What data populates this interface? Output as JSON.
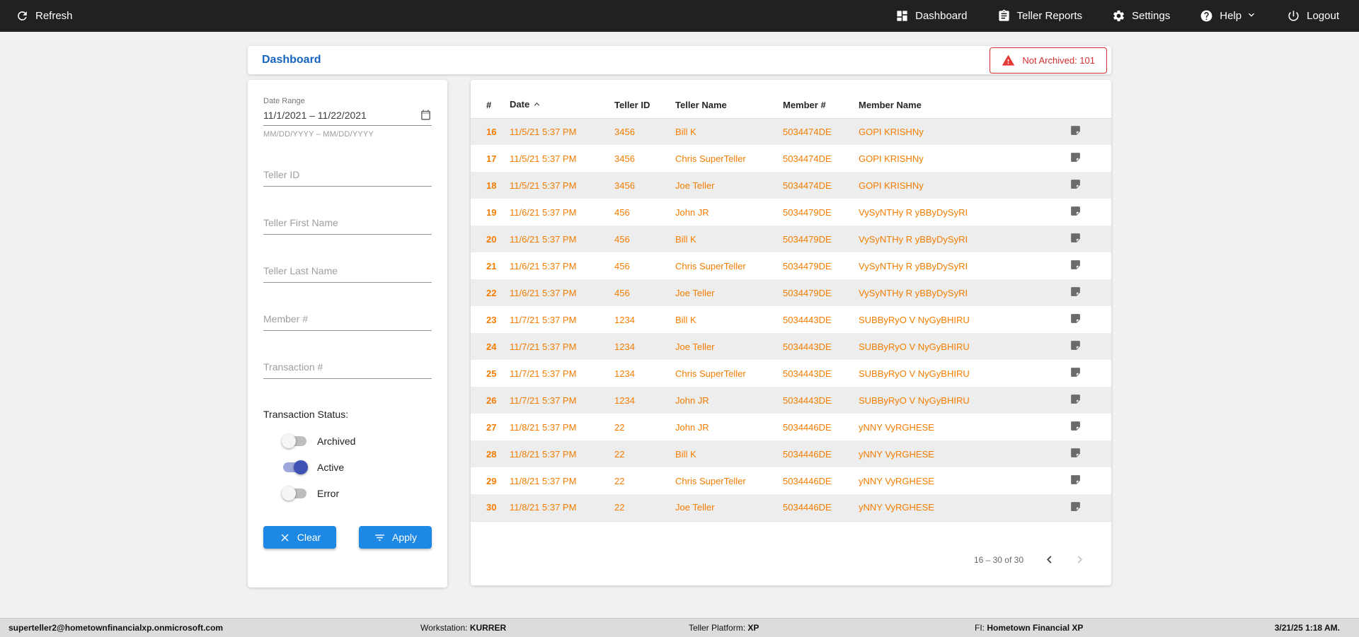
{
  "colors": {
    "accent_blue": "#1E88E5",
    "title_blue": "#1565C0",
    "row_orange": "#F57C00",
    "alert_red": "#D32F2F",
    "toggle_active_blue": "#3F51B5",
    "topnav_bg": "#212121"
  },
  "topnav": {
    "refresh_label": "Refresh",
    "items": [
      {
        "label": "Dashboard",
        "icon": "dashboard-icon"
      },
      {
        "label": "Teller Reports",
        "icon": "teller-reports-icon"
      },
      {
        "label": "Settings",
        "icon": "settings-icon"
      },
      {
        "label": "Help",
        "icon": "help-icon"
      },
      {
        "label": "Logout",
        "icon": "logout-icon"
      }
    ]
  },
  "header": {
    "title": "Dashboard",
    "not_archived_badge": "Not Archived: 101"
  },
  "filters": {
    "date_range": {
      "label": "Date Range",
      "value": "11/1/2021 – 11/22/2021",
      "helper": "MM/DD/YYYY – MM/DD/YYYY"
    },
    "fields": [
      {
        "placeholder": "Teller ID"
      },
      {
        "placeholder": "Teller First Name"
      },
      {
        "placeholder": "Teller Last Name"
      },
      {
        "placeholder": "Member #"
      },
      {
        "placeholder": "Transaction #"
      }
    ],
    "status_label": "Transaction Status:",
    "toggles": [
      {
        "label": "Archived",
        "on": false
      },
      {
        "label": "Active",
        "on": true
      },
      {
        "label": "Error",
        "on": false
      }
    ],
    "clear_label": "Clear",
    "apply_label": "Apply"
  },
  "table": {
    "columns": [
      "#",
      "Date",
      "Teller ID",
      "Teller Name",
      "Member #",
      "Member Name"
    ],
    "sorted_by": "Date",
    "sort_direction": "asc",
    "rows": [
      {
        "num": "16",
        "date": "11/5/21 5:37 PM",
        "teller_id": "3456",
        "teller_name": "Bill K",
        "member_num": "5034474DE",
        "member_name": "GOPI KRISHNy"
      },
      {
        "num": "17",
        "date": "11/5/21 5:37 PM",
        "teller_id": "3456",
        "teller_name": "Chris SuperTeller",
        "member_num": "5034474DE",
        "member_name": "GOPI KRISHNy"
      },
      {
        "num": "18",
        "date": "11/5/21 5:37 PM",
        "teller_id": "3456",
        "teller_name": "Joe Teller",
        "member_num": "5034474DE",
        "member_name": "GOPI KRISHNy"
      },
      {
        "num": "19",
        "date": "11/6/21 5:37 PM",
        "teller_id": "456",
        "teller_name": "John JR",
        "member_num": "5034479DE",
        "member_name": "VySyNTHy R yBByDySyRI"
      },
      {
        "num": "20",
        "date": "11/6/21 5:37 PM",
        "teller_id": "456",
        "teller_name": "Bill K",
        "member_num": "5034479DE",
        "member_name": "VySyNTHy R yBByDySyRI"
      },
      {
        "num": "21",
        "date": "11/6/21 5:37 PM",
        "teller_id": "456",
        "teller_name": "Chris SuperTeller",
        "member_num": "5034479DE",
        "member_name": "VySyNTHy R yBByDySyRI"
      },
      {
        "num": "22",
        "date": "11/6/21 5:37 PM",
        "teller_id": "456",
        "teller_name": "Joe Teller",
        "member_num": "5034479DE",
        "member_name": "VySyNTHy R yBByDySyRI"
      },
      {
        "num": "23",
        "date": "11/7/21 5:37 PM",
        "teller_id": "1234",
        "teller_name": "Bill K",
        "member_num": "5034443DE",
        "member_name": "SUBByRyO V NyGyBHIRU"
      },
      {
        "num": "24",
        "date": "11/7/21 5:37 PM",
        "teller_id": "1234",
        "teller_name": "Joe Teller",
        "member_num": "5034443DE",
        "member_name": "SUBByRyO V NyGyBHIRU"
      },
      {
        "num": "25",
        "date": "11/7/21 5:37 PM",
        "teller_id": "1234",
        "teller_name": "Chris SuperTeller",
        "member_num": "5034443DE",
        "member_name": "SUBByRyO V NyGyBHIRU"
      },
      {
        "num": "26",
        "date": "11/7/21 5:37 PM",
        "teller_id": "1234",
        "teller_name": "John JR",
        "member_num": "5034443DE",
        "member_name": "SUBByRyO V NyGyBHIRU"
      },
      {
        "num": "27",
        "date": "11/8/21 5:37 PM",
        "teller_id": "22",
        "teller_name": "John JR",
        "member_num": "5034446DE",
        "member_name": "yNNY VyRGHESE"
      },
      {
        "num": "28",
        "date": "11/8/21 5:37 PM",
        "teller_id": "22",
        "teller_name": "Bill K",
        "member_num": "5034446DE",
        "member_name": "yNNY VyRGHESE"
      },
      {
        "num": "29",
        "date": "11/8/21 5:37 PM",
        "teller_id": "22",
        "teller_name": "Chris SuperTeller",
        "member_num": "5034446DE",
        "member_name": "yNNY VyRGHESE"
      },
      {
        "num": "30",
        "date": "11/8/21 5:37 PM",
        "teller_id": "22",
        "teller_name": "Joe Teller",
        "member_num": "5034446DE",
        "member_name": "yNNY VyRGHESE"
      }
    ],
    "pagination": {
      "range_label": "16 – 30 of 30"
    }
  },
  "footer": {
    "email": "superteller2@hometownfinancialxp.onmicrosoft.com",
    "workstation_label": "Workstation:",
    "workstation_value": "KURRER",
    "platform_label": "Teller Platform:",
    "platform_value": "XP",
    "fi_label": "FI:",
    "fi_value": "Hometown Financial XP",
    "datetime": "3/21/25 1:18 AM."
  }
}
